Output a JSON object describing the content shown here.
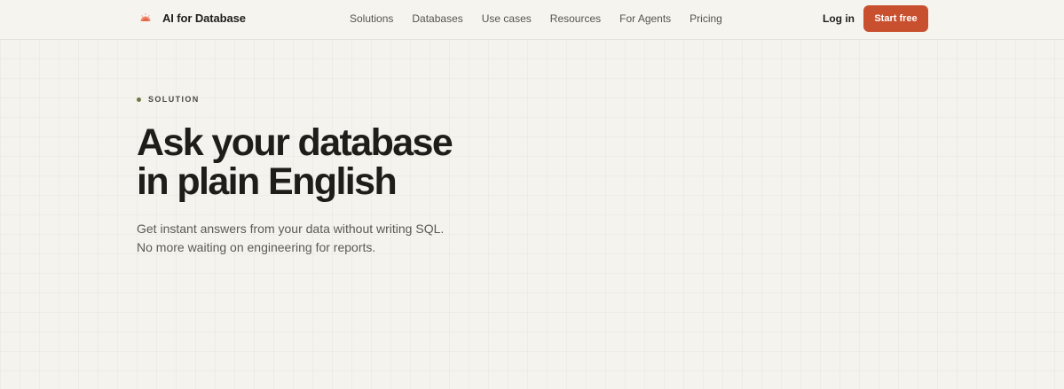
{
  "header": {
    "brand": {
      "name": "AI for Database",
      "icon": "sunrise-logo-icon",
      "accent": "#e2674a"
    },
    "nav": [
      {
        "label": "Solutions"
      },
      {
        "label": "Databases"
      },
      {
        "label": "Use cases"
      },
      {
        "label": "Resources"
      },
      {
        "label": "For Agents"
      },
      {
        "label": "Pricing"
      }
    ],
    "login_label": "Log in",
    "cta_label": "Start free",
    "cta_color": "#c9502f"
  },
  "hero": {
    "eyebrow": "SOLUTION",
    "eyebrow_dot_color": "#6d7a47",
    "headline_lines": [
      "Ask your database",
      "in plain English"
    ],
    "subtext_lines": [
      "Get instant answers from your data without writing SQL.",
      "No more waiting on engineering for reports."
    ]
  }
}
